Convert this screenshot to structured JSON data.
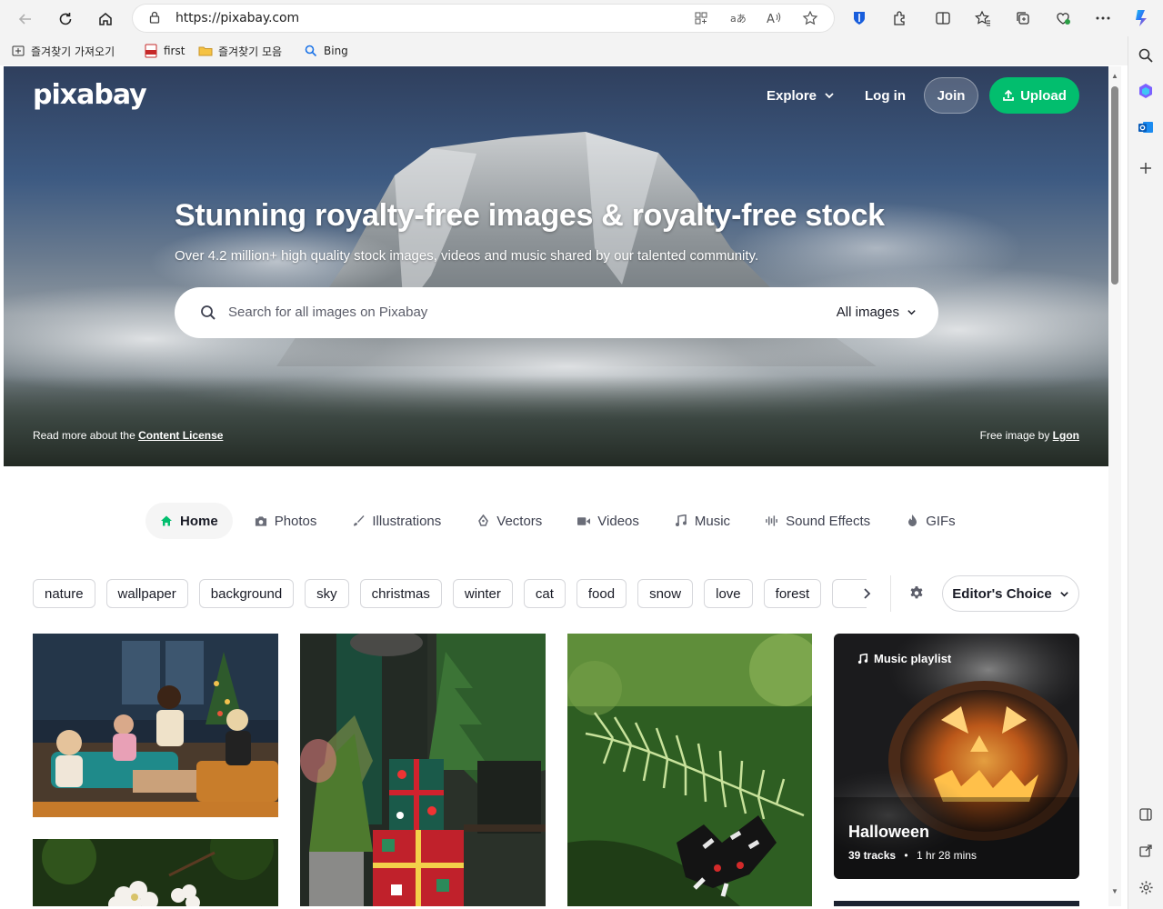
{
  "browser": {
    "url_host": "https://pixabay.com",
    "favorites": [
      {
        "label": "즐겨찾기 가져오기",
        "icon": "import-favorites-icon"
      },
      {
        "label": "first",
        "icon": "pdf-icon"
      },
      {
        "label": "즐겨찾기 모음",
        "icon": "folder-icon"
      },
      {
        "label": "Bing",
        "icon": "search-icon"
      }
    ]
  },
  "header": {
    "logo": "pixabay",
    "explore": "Explore",
    "login": "Log in",
    "join": "Join",
    "upload": "Upload"
  },
  "hero": {
    "title": "Stunning royalty-free images & royalty-free stock",
    "subtitle": "Over 4.2 million+ high quality stock images, videos and music shared by our talented community.",
    "search_placeholder": "Search for all images on Pixabay",
    "search_scope": "All images",
    "license_prefix": "Read more about the ",
    "license_link": "Content License",
    "credit_prefix": "Free image by ",
    "credit_author": "Lgon"
  },
  "categories": [
    {
      "label": "Home",
      "icon": "home-icon",
      "active": true
    },
    {
      "label": "Photos",
      "icon": "camera-icon",
      "active": false
    },
    {
      "label": "Illustrations",
      "icon": "brush-icon",
      "active": false
    },
    {
      "label": "Vectors",
      "icon": "pen-tool-icon",
      "active": false
    },
    {
      "label": "Videos",
      "icon": "video-camera-icon",
      "active": false
    },
    {
      "label": "Music",
      "icon": "music-note-icon",
      "active": false
    },
    {
      "label": "Sound Effects",
      "icon": "waveform-icon",
      "active": false
    },
    {
      "label": "GIFs",
      "icon": "flame-icon",
      "active": false
    }
  ],
  "tags": [
    "nature",
    "wallpaper",
    "background",
    "sky",
    "christmas",
    "winter",
    "cat",
    "food",
    "snow",
    "love",
    "forest"
  ],
  "sort": "Editor's Choice",
  "playlist": {
    "tag": "Music playlist",
    "title": "Halloween",
    "tracks": "39 tracks",
    "duration": "1 hr 28 mins"
  },
  "colors": {
    "brand_green": "#02be6e",
    "text_dark": "#191b26",
    "tag_border": "#d6d7db"
  }
}
